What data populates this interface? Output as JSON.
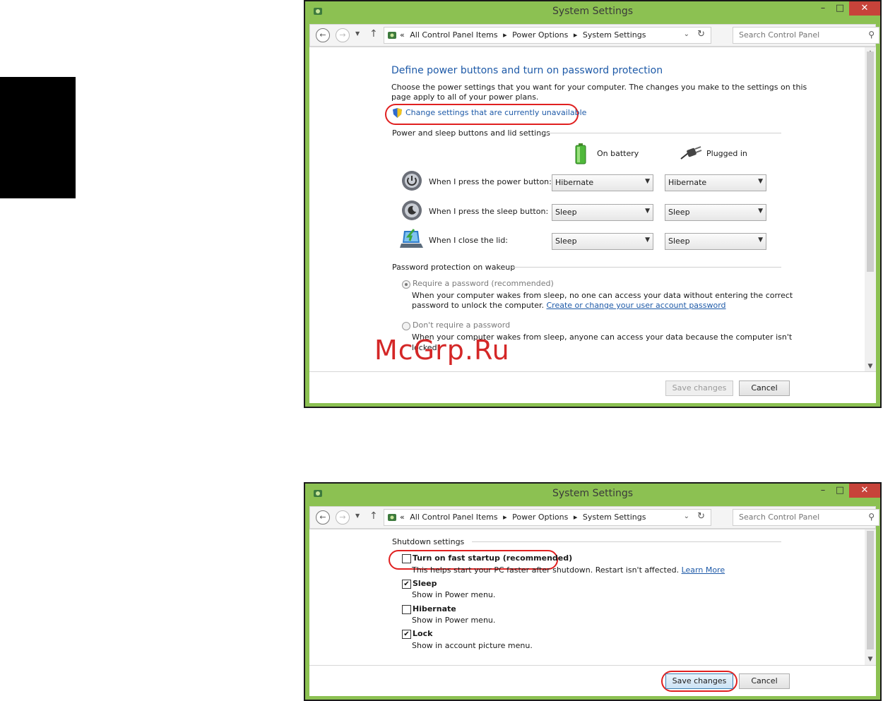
{
  "window_top": {
    "title": "System Settings",
    "controls": {
      "minimize": "–",
      "maximize": "□",
      "close": "✕"
    },
    "address": {
      "prefix": "«",
      "crumbs": [
        "All Control Panel Items",
        "▸",
        "Power Options",
        "▸",
        "System Settings"
      ]
    },
    "search_placeholder": "Search Control Panel",
    "heading": "Define power buttons and turn on password protection",
    "intro_line1": "Choose the power settings that you want for your computer. The changes you make to the settings on this",
    "intro_line2": "page apply to all of your power plans.",
    "change_link": "Change settings that are currently unavailable",
    "section_buttons": "Power and sleep buttons and lid settings",
    "col_battery": "On battery",
    "col_plugged": "Plugged in",
    "rows": [
      {
        "label": "When I press the power button:",
        "battery": "Hibernate",
        "plugged": "Hibernate"
      },
      {
        "label": "When I press the sleep button:",
        "battery": "Sleep",
        "plugged": "Sleep"
      },
      {
        "label": "When I close the lid:",
        "battery": "Sleep",
        "plugged": "Sleep"
      }
    ],
    "section_password": "Password protection on wakeup",
    "require_label": "Require a password (recommended)",
    "require_desc1": "When your computer wakes from sleep, no one can access your data without entering the correct",
    "require_desc2": "password to unlock the computer.",
    "require_link": "Create or change your user account password",
    "norequire_label": "Don't require a password",
    "norequire_desc1": "When your computer wakes from sleep, anyone can access your data because the computer isn't",
    "norequire_desc2": "locked.",
    "save": "Save changes",
    "cancel": "Cancel"
  },
  "window_bottom": {
    "title": "System Settings",
    "controls": {
      "minimize": "–",
      "maximize": "□",
      "close": "✕"
    },
    "address": {
      "prefix": "«",
      "crumbs": [
        "All Control Panel Items",
        "▸",
        "Power Options",
        "▸",
        "System Settings"
      ]
    },
    "search_placeholder": "Search Control Panel",
    "section_shutdown": "Shutdown settings",
    "fast_startup_label": "Turn on fast startup (recommended)",
    "fast_startup_desc": "This helps start your PC faster after shutdown. Restart isn't affected.",
    "learn_more": "Learn More",
    "sleep_label": "Sleep",
    "sleep_desc": "Show in Power menu.",
    "hibernate_label": "Hibernate",
    "hibernate_desc": "Show in Power menu.",
    "lock_label": "Lock",
    "lock_desc": "Show in account picture menu.",
    "checked": {
      "fast_startup": false,
      "sleep": true,
      "hibernate": false,
      "lock": true
    },
    "save": "Save changes",
    "cancel": "Cancel"
  },
  "watermark": "McGrp.Ru",
  "colors": {
    "frame": "#8cc152",
    "link": "#1e5aa8",
    "highlight": "#e02020",
    "close": "#c7433a"
  }
}
